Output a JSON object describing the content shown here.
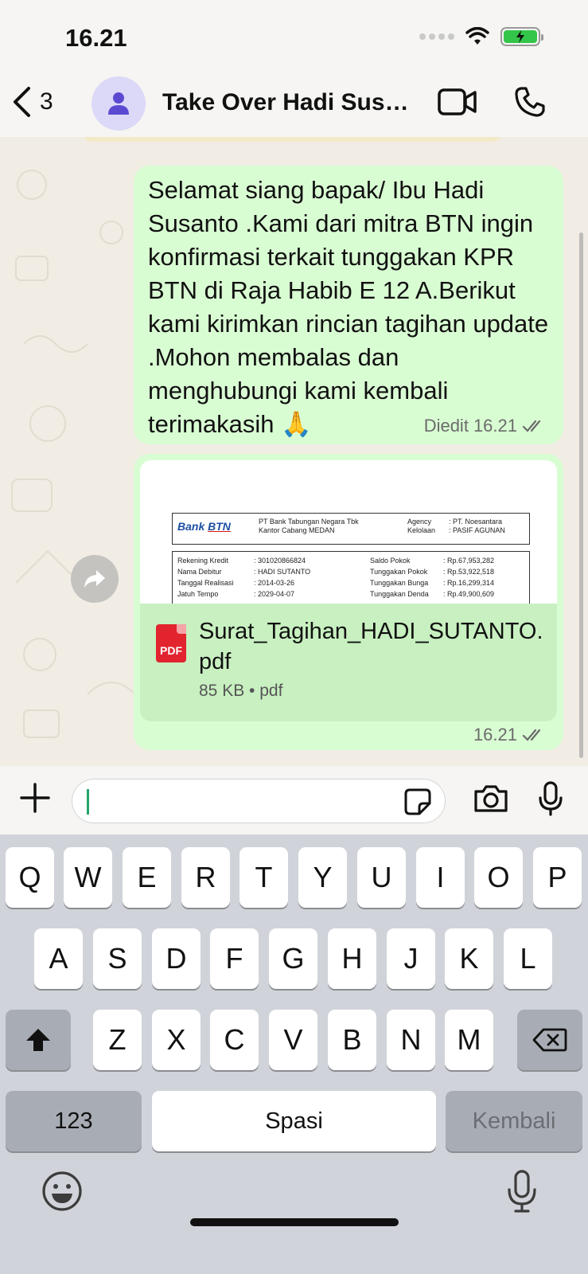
{
  "status": {
    "time": "16.21"
  },
  "header": {
    "back_count": "3",
    "title": "Take Over Hadi Susa...",
    "icons": [
      "back-chevron-icon",
      "contact-avatar-icon",
      "video-call-icon",
      "phone-call-icon"
    ]
  },
  "messages": [
    {
      "type": "text",
      "text": "Selamat siang bapak/ Ibu Hadi Susanto .Kami dari mitra BTN ingin konfirmasi terkait tunggakan KPR BTN di Raja Habib E 12 A.Berikut kami kirimkan rincian tagihan update .Mohon membalas dan menghubungi kami kembali terimakasih 🙏",
      "edited_label": "Diedit",
      "time": "16.21"
    },
    {
      "type": "document",
      "preview": {
        "bank_logo": "Bank",
        "bank_logo_brand": "BTN",
        "bank_name": "PT Bank Tabungan Negara Tbk",
        "branch": "Kantor Cabang MEDAN",
        "agency_label": "Agency",
        "agency_value": ": PT. Noesantara",
        "kelolaan_label": "Kelolaan",
        "kelolaan_value": ": PASIF AGUNAN",
        "rows": [
          {
            "k1": "Rekening Kredit",
            "v1": ": 301020866824",
            "k2": "Saldo Pokok",
            "v2": ": Rp.67,953,282"
          },
          {
            "k1": "Nama Debitur",
            "v1": ": HADI SUTANTO",
            "k2": "Tunggakan Pokok",
            "v2": ": Rp.53,922,518"
          },
          {
            "k1": "Tanggal Realisasi",
            "v1": ": 2014-03-26",
            "k2": "Tunggakan Bunga",
            "v2": ": Rp.16,299,314"
          },
          {
            "k1": "Jatuh Tempo",
            "v1": ": 2029-04-07",
            "k2": "Tunggakan Denda",
            "v2": ": Rp.49,900,609"
          }
        ]
      },
      "file_icon_label": "PDF",
      "file_name": "Surat_Tagihan_HADI_SUTANTO.pdf",
      "file_info": "85 KB • pdf",
      "time": "16.21"
    }
  ],
  "input": {
    "placeholder": ""
  },
  "keyboard": {
    "row1": [
      "Q",
      "W",
      "E",
      "R",
      "T",
      "Y",
      "U",
      "I",
      "O",
      "P"
    ],
    "row2": [
      "A",
      "S",
      "D",
      "F",
      "G",
      "H",
      "J",
      "K",
      "L"
    ],
    "row3": [
      "Z",
      "X",
      "C",
      "V",
      "B",
      "N",
      "M"
    ],
    "numbers_key": "123",
    "space_key": "Spasi",
    "return_key": "Kembali"
  },
  "colors": {
    "outgoing_bubble": "#d9fdd3",
    "document_footer": "#c8f0c0",
    "pdf_red": "#e2242f",
    "avatar_bg": "#dcd8f7",
    "accent_green": "#25a56b"
  }
}
